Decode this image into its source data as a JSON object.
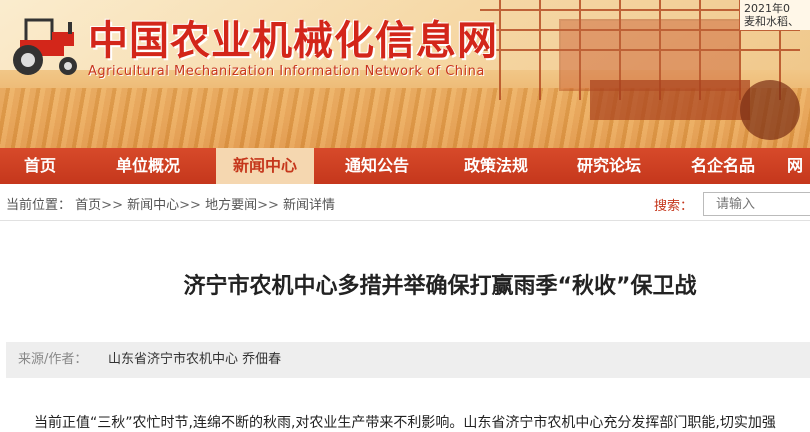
{
  "header": {
    "site_title": "中国农业机械化信息网",
    "site_subtitle": "Agricultural Mechanization Information Network of China",
    "date_line1": "2021年0",
    "date_line2": "麦和水稻、"
  },
  "nav": {
    "items": [
      {
        "label": "首页",
        "active": false
      },
      {
        "label": "单位概况",
        "active": false
      },
      {
        "label": "新闻中心",
        "active": true
      },
      {
        "label": "通知公告",
        "active": false
      },
      {
        "label": "政策法规",
        "active": false
      },
      {
        "label": "研究论坛",
        "active": false
      },
      {
        "label": "名企名品",
        "active": false
      },
      {
        "label": "网",
        "active": false
      }
    ]
  },
  "breadcrumb": {
    "prefix": "当前位置：",
    "items": [
      "首页",
      "新闻中心",
      "地方要闻",
      "新闻详情"
    ],
    "separator": ">>"
  },
  "search": {
    "label": "搜索：",
    "placeholder": "请输入"
  },
  "article": {
    "title": "济宁市农机中心多措并举确保打赢雨季“秋收”保卫战",
    "source_label": "来源/作者：",
    "source_value": "山东省济宁市农机中心 乔佃春",
    "first_line": "当前正值“三秋”农忙时节,连绵不断的秋雨,对农业生产带来不利影响。山东省济宁市农机中心充分发挥部门职能,切实加强"
  },
  "colors": {
    "brand_red": "#d3261a",
    "nav_red": "#c5371c",
    "nav_active_bg": "#f5d7b0"
  }
}
